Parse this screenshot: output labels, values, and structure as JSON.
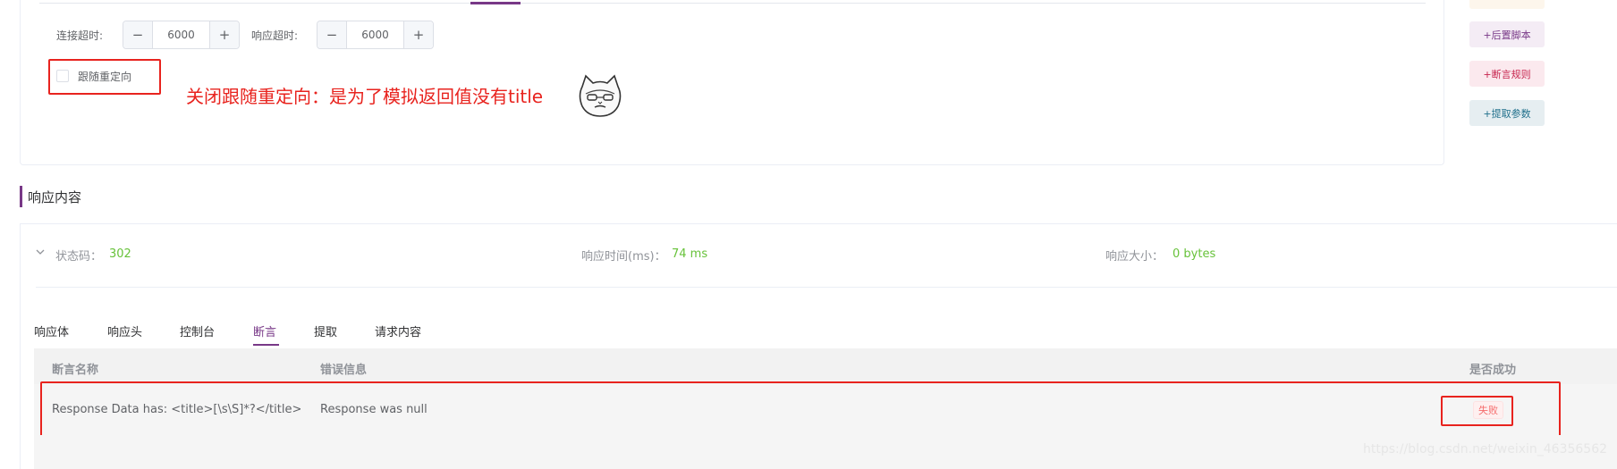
{
  "config": {
    "connect_timeout_label": "连接超时:",
    "connect_timeout_value": "6000",
    "response_timeout_label": "响应超时:",
    "response_timeout_value": "6000",
    "stepper_minus": "−",
    "stepper_plus": "+",
    "follow_redirect_label": "跟随重定向",
    "follow_redirect_checked": false
  },
  "annotation": {
    "text": "关闭跟随重定向：是为了模拟返回值没有title"
  },
  "side_actions": [
    {
      "label": "+后置脚本",
      "color": "#783887"
    },
    {
      "label": "+断言规则",
      "color": "#c7254e"
    },
    {
      "label": "+提取参数",
      "color": "#1f6f8b"
    }
  ],
  "response": {
    "title": "响应内容",
    "status_label": "状态码：",
    "status_value": "302",
    "time_label": "响应时间(ms)：",
    "time_value": "74 ms",
    "size_label": "响应大小：",
    "size_value": "0 bytes",
    "tabs": [
      {
        "label": "响应体",
        "active": false
      },
      {
        "label": "响应头",
        "active": false
      },
      {
        "label": "控制台",
        "active": false
      },
      {
        "label": "断言",
        "active": true
      },
      {
        "label": "提取",
        "active": false
      },
      {
        "label": "请求内容",
        "active": false
      }
    ],
    "table": {
      "columns": [
        "断言名称",
        "错误信息",
        "是否成功"
      ],
      "rows": [
        {
          "name": "Response Data has: <title>[\\s\\S]*?</title>",
          "error": "Response was null",
          "result": "失败"
        }
      ]
    }
  },
  "watermark": "https://blog.csdn.net/weixin_46356562",
  "colors": {
    "accent": "#783887",
    "success": "#67c23a",
    "danger": "#f56c6c",
    "annotation": "#e8231e"
  }
}
